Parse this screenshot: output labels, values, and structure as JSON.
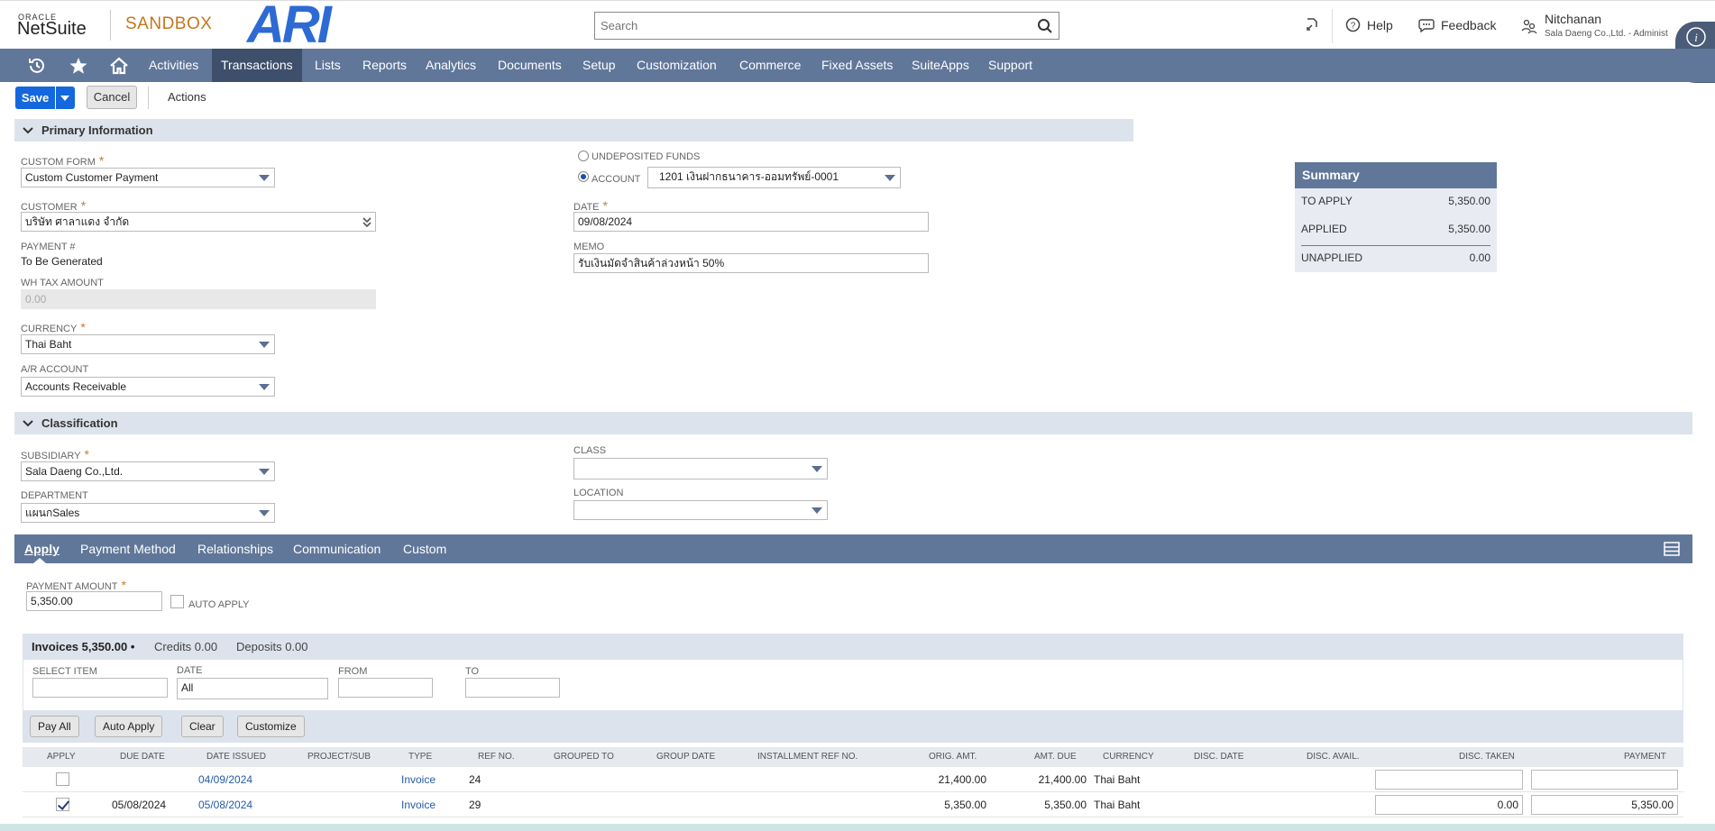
{
  "header": {
    "oracle": "ORACLE",
    "netsuite": "NetSuite",
    "environment": "SANDBOX",
    "brand": "ARI",
    "search_placeholder": "Search",
    "help": "Help",
    "feedback": "Feedback",
    "user_name": "Nitchanan",
    "user_role": "Sala Daeng Co.,Ltd. - Administ"
  },
  "nav": {
    "items": [
      "Activities",
      "Transactions",
      "Lists",
      "Reports",
      "Analytics",
      "Documents",
      "Setup",
      "Customization",
      "Commerce",
      "Fixed Assets",
      "SuiteApps",
      "Support"
    ],
    "active": "Transactions"
  },
  "toolbar": {
    "save": "Save",
    "cancel": "Cancel",
    "actions": "Actions"
  },
  "primary": {
    "title": "Primary Information",
    "custom_form_label": "CUSTOM FORM",
    "custom_form_value": "Custom Customer Payment",
    "customer_label": "CUSTOMER",
    "customer_value": "บริษัท ศาลาแดง จำกัด",
    "payment_no_label": "PAYMENT #",
    "payment_no_value": "To Be Generated",
    "wh_tax_label": "WH TAX AMOUNT",
    "wh_tax_value": "0.00",
    "currency_label": "CURRENCY",
    "currency_value": "Thai Baht",
    "ar_account_label": "A/R ACCOUNT",
    "ar_account_value": "Accounts Receivable",
    "undeposited_label": "UNDEPOSITED FUNDS",
    "account_label": "ACCOUNT",
    "account_value": "1201 เงินฝากธนาคาร-ออมทรัพย์-0001",
    "date_label": "DATE",
    "date_value": "09/08/2024",
    "memo_label": "MEMO",
    "memo_value": "รับเงินมัดจำสินค้าล่วงหน้า 50%"
  },
  "summary": {
    "title": "Summary",
    "to_apply_label": "TO APPLY",
    "to_apply": "5,350.00",
    "applied_label": "APPLIED",
    "applied": "5,350.00",
    "unapplied_label": "UNAPPLIED",
    "unapplied": "0.00"
  },
  "classification": {
    "title": "Classification",
    "subsidiary_label": "SUBSIDIARY",
    "subsidiary_value": "Sala Daeng Co.,Ltd.",
    "department_label": "DEPARTMENT",
    "department_value": "แผนกSales",
    "class_label": "CLASS",
    "class_value": "",
    "location_label": "LOCATION",
    "location_value": ""
  },
  "tabs": [
    "Apply",
    "Payment Method",
    "Relationships",
    "Communication",
    "Custom"
  ],
  "apply": {
    "payment_amount_label": "PAYMENT AMOUNT",
    "payment_amount": "5,350.00",
    "auto_apply_label": "AUTO APPLY",
    "sublist_tabs": [
      "Invoices 5,350.00 •",
      "Credits 0.00",
      "Deposits 0.00"
    ],
    "filters": {
      "select_item_label": "SELECT ITEM",
      "date_label": "DATE",
      "date_value": "All",
      "from_label": "FROM",
      "to_label": "TO"
    },
    "buttons": [
      "Pay All",
      "Auto Apply",
      "Clear",
      "Customize"
    ],
    "columns": [
      "APPLY",
      "DUE DATE",
      "DATE ISSUED",
      "PROJECT/SUB",
      "TYPE",
      "REF NO.",
      "GROUPED TO",
      "GROUP DATE",
      "INSTALLMENT REF NO.",
      "ORIG. AMT.",
      "AMT. DUE",
      "CURRENCY",
      "DISC. DATE",
      "DISC. AVAIL.",
      "DISC. TAKEN",
      "PAYMENT"
    ],
    "rows": [
      {
        "apply": false,
        "due_date": "",
        "date_issued": "04/09/2024",
        "type": "Invoice",
        "ref_no": "24",
        "orig_amt": "21,400.00",
        "amt_due": "21,400.00",
        "currency": "Thai Baht",
        "disc_taken": "",
        "payment": ""
      },
      {
        "apply": true,
        "due_date": "05/08/2024",
        "date_issued": "05/08/2024",
        "type": "Invoice",
        "ref_no": "29",
        "orig_amt": "5,350.00",
        "amt_due": "5,350.00",
        "currency": "Thai Baht",
        "disc_taken": "0.00",
        "payment": "5,350.00"
      }
    ]
  },
  "colors": {
    "nav_bg": "#607799",
    "nav_active": "#3d4f6b",
    "save_blue": "#1467dd",
    "section_bg": "#dde3ec",
    "sandbox": "#c4761d",
    "link": "#255ba5"
  },
  "icons": [
    "search-icon",
    "recent-icon",
    "star-icon",
    "home-icon",
    "help-icon",
    "feedback-icon",
    "roles-icon",
    "info-icon",
    "chevron-down-icon",
    "customize-view-icon"
  ]
}
